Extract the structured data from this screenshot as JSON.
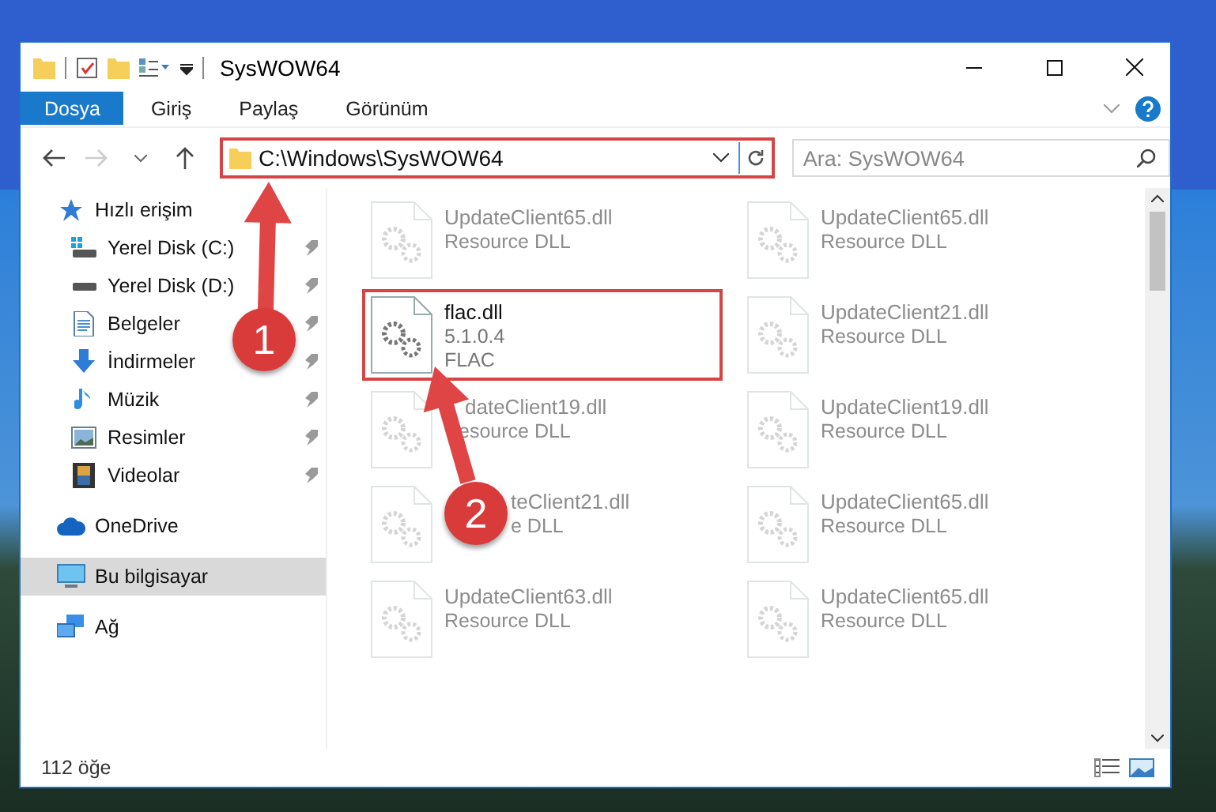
{
  "window": {
    "title": "SysWOW64"
  },
  "ribbon_tabs": [
    {
      "label": "Dosya",
      "selected": true
    },
    {
      "label": "Giriş",
      "selected": false
    },
    {
      "label": "Paylaş",
      "selected": false
    },
    {
      "label": "Görünüm",
      "selected": false
    }
  ],
  "address_bar": {
    "path": "C:\\Windows\\SysWOW64",
    "highlighted": true
  },
  "search": {
    "placeholder": "Ara: SysWOW64"
  },
  "sidebar": {
    "items": [
      {
        "label": "Hızlı erişim",
        "kind": "star",
        "selected": false,
        "pinned": false,
        "children": [
          {
            "label": "Yerel Disk (C:)",
            "kind": "system-drive",
            "selected": false,
            "pinned": true
          },
          {
            "label": "Yerel Disk (D:)",
            "kind": "drive",
            "selected": false,
            "pinned": true
          },
          {
            "label": "Belgeler",
            "kind": "documents",
            "selected": false,
            "pinned": true
          },
          {
            "label": "İndirmeler",
            "kind": "download",
            "selected": false,
            "pinned": true
          },
          {
            "label": "Müzik",
            "kind": "music",
            "selected": false,
            "pinned": true
          },
          {
            "label": "Resimler",
            "kind": "pictures",
            "selected": false,
            "pinned": true
          },
          {
            "label": "Videolar",
            "kind": "video",
            "selected": false,
            "pinned": true
          }
        ]
      },
      {
        "label": "OneDrive",
        "kind": "cloud",
        "selected": false,
        "pinned": false
      },
      {
        "label": "Bu bilgisayar",
        "kind": "computer",
        "selected": true,
        "pinned": false
      },
      {
        "label": "Ağ",
        "kind": "network",
        "selected": false,
        "pinned": false
      }
    ]
  },
  "files": [
    {
      "name": "UpdateClient65.dll",
      "details": [
        "Resource DLL"
      ],
      "dimmed": true,
      "highlighted": false
    },
    {
      "name": "UpdateClient65.dll",
      "details": [
        "Resource DLL"
      ],
      "dimmed": true,
      "highlighted": false
    },
    {
      "name": "flac.dll",
      "details": [
        "5.1.0.4",
        "FLAC"
      ],
      "dimmed": false,
      "highlighted": true
    },
    {
      "name": "UpdateClient21.dll",
      "details": [
        "Resource DLL"
      ],
      "dimmed": true,
      "highlighted": false
    },
    {
      "name": "dateClient19.dll",
      "details": [
        "esource DLL"
      ],
      "dimmed": true,
      "highlighted": false
    },
    {
      "name": "UpdateClient19.dll",
      "details": [
        "Resource DLL"
      ],
      "dimmed": true,
      "highlighted": false
    },
    {
      "name": "teClient21.dll",
      "details": [
        "e DLL"
      ],
      "dimmed": true,
      "highlighted": false
    },
    {
      "name": "UpdateClient65.dll",
      "details": [
        "Resource DLL"
      ],
      "dimmed": true,
      "highlighted": false
    },
    {
      "name": "UpdateClient63.dll",
      "details": [
        "Resource DLL"
      ],
      "dimmed": true,
      "highlighted": false
    },
    {
      "name": "UpdateClient65.dll",
      "details": [
        "Resource DLL"
      ],
      "dimmed": true,
      "highlighted": false
    }
  ],
  "annotations": [
    {
      "label": "1"
    },
    {
      "label": "2"
    }
  ],
  "status_bar": {
    "item_count": "112 öğe"
  }
}
